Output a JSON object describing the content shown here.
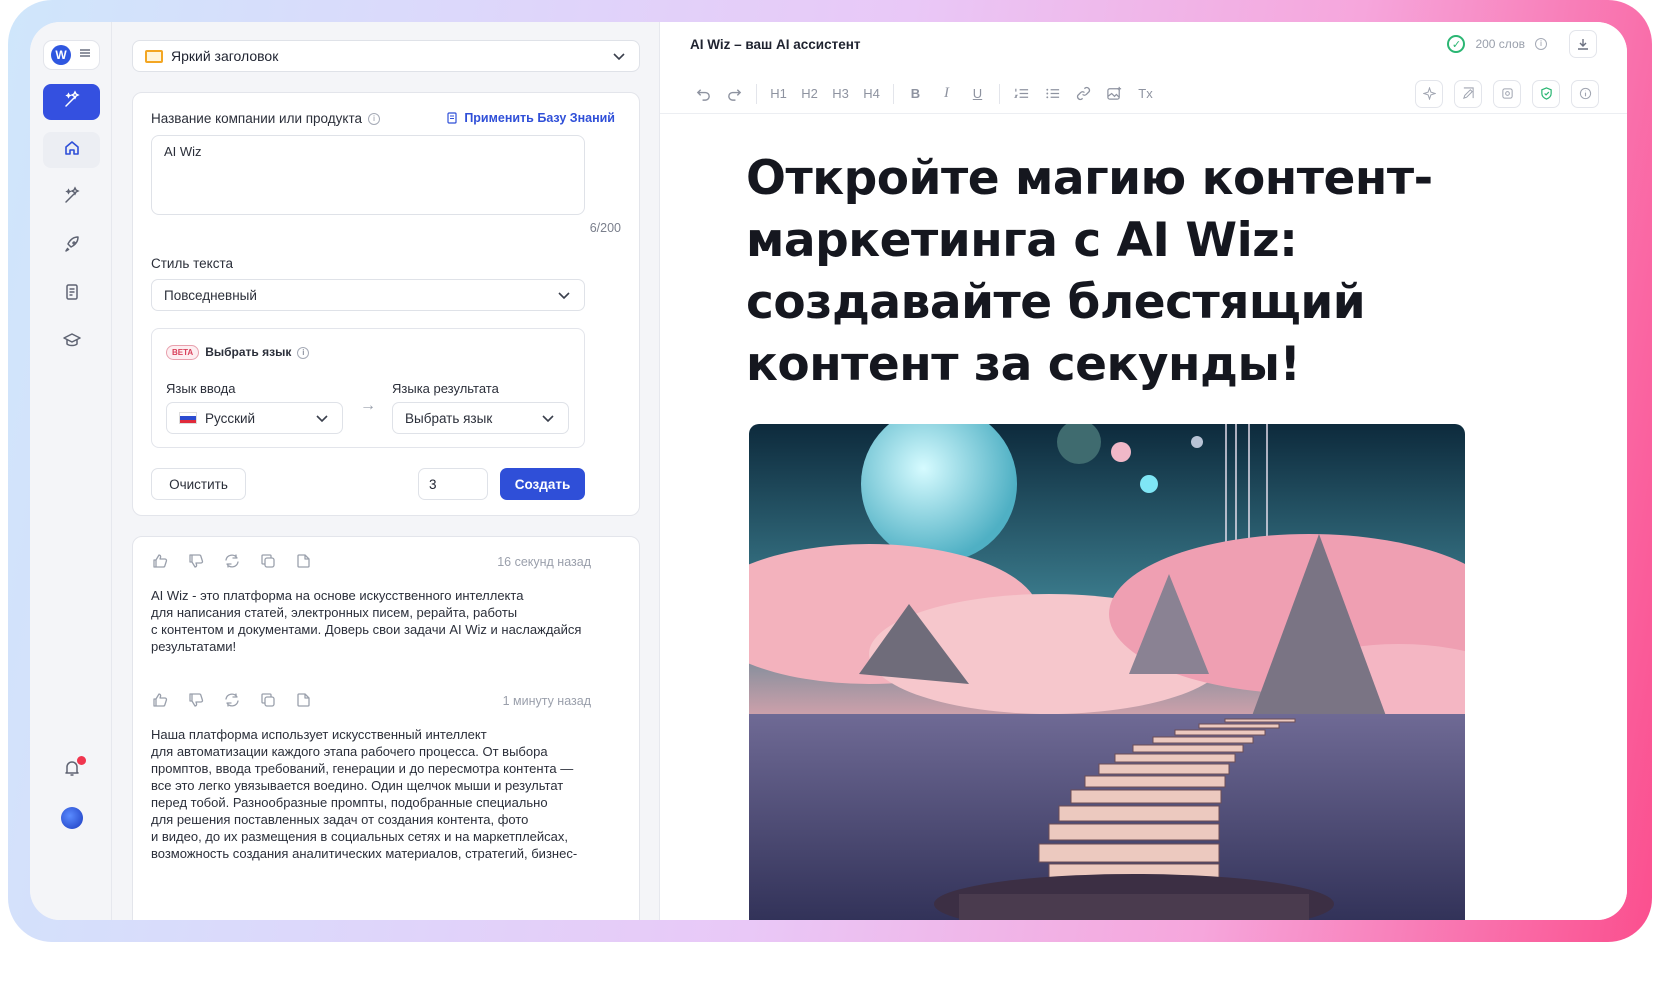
{
  "app": {
    "logo_letter": "W"
  },
  "panel": {
    "template_select": "Яркий заголовок",
    "company_label": "Название компании или продукта",
    "knowledge_base_link": "Применить Базу Знаний",
    "company_value": "AI Wiz",
    "counter": "6/200",
    "style_label": "Стиль текста",
    "style_value": "Повседневный",
    "beta_badge": "BETA",
    "language_title": "Выбрать язык",
    "input_lang_label": "Язык ввода",
    "input_lang_value": "Русский",
    "output_lang_label": "Языка результата",
    "output_lang_value": "Выбрать язык",
    "clear_button": "Очистить",
    "count_value": "3",
    "create_button": "Создать"
  },
  "results": [
    {
      "time": "16 секунд назад",
      "text": "AI Wiz - это платформа на основе искусственного интеллекта\nдля написания статей, электронных писем, рерайта, работы\nс контентом и документами. Доверь свои задачи AI Wiz и наслаждайся\nрезультатами!"
    },
    {
      "time": "1 минуту назад",
      "text": "Наша платформа использует искусственный интеллект\nдля автоматизации каждого этапа рабочего процесса. От выбора\nпромптов, ввода требований, генерации и до пересмотра контента —\nвсе это легко увязывается воедино. Один щелчок мыши и результат\nперед тобой. Разнообразные промпты, подобранные специально\nдля решения поставленных задач от создания контента, фото\nи видео, до их размещения в социальных сетях и на маркетплейсах,\nвозможность создания аналитических материалов, стратегий, бизнес-"
    }
  ],
  "editor": {
    "doc_title": "AI Wiz – ваш AI ассистент",
    "word_count": "200 слов",
    "toolbar_headings": [
      "H1",
      "H2",
      "H3",
      "H4"
    ],
    "toolbar_bold": "B",
    "toolbar_italic": "I",
    "toolbar_underline": "U",
    "toolbar_clear": "Tx",
    "headline": "Откройте магию контент-маркетинга с AI Wiz: создавайте блестящий контент за секунды!"
  }
}
